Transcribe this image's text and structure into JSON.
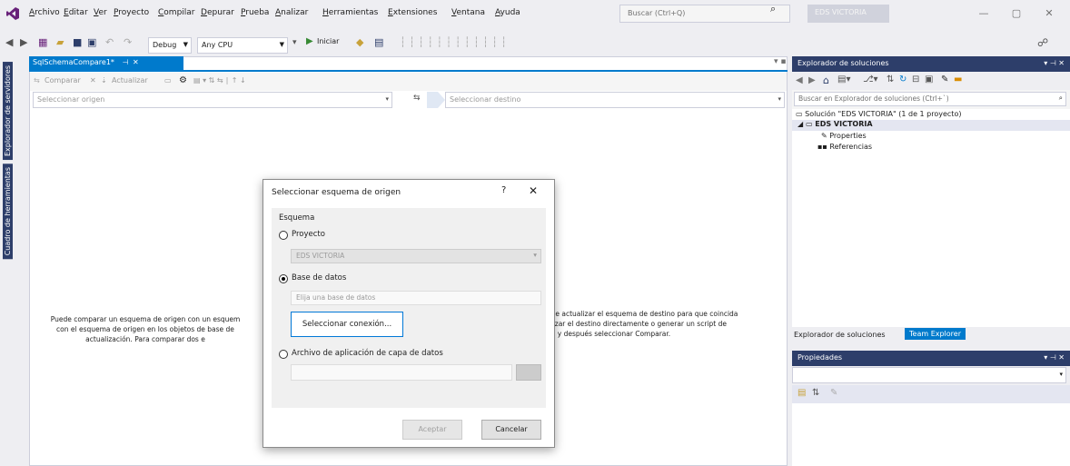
{
  "menu": [
    "Archivo",
    "Editar",
    "Ver",
    "Proyecto",
    "Compilar",
    "Depurar",
    "Prueba",
    "Analizar",
    "Herramientas",
    "Extensiones",
    "Ventana",
    "Ayuda"
  ],
  "search": {
    "placeholder": "Buscar (Ctrl+Q)"
  },
  "solution_badge": "EDS VICTORIA",
  "toolbar": {
    "config": "Debug",
    "platform": "Any CPU",
    "start": "Iniciar"
  },
  "left_rail": {
    "tab1": "Explorador de servidores",
    "tab2": "Cuadro de herramientas"
  },
  "document": {
    "tab_title": "SqlSchemaCompare1*",
    "toolbar_compare": "Comparar",
    "toolbar_update": "Actualizar",
    "source_placeholder": "Seleccionar origen",
    "target_placeholder": "Seleccionar destino",
    "desc_left": "Puede comparar un esquema de origen con un esquema de destino. Puede actualizar el esquema de destino para que coincida con el esquema de origen en los objetos de base de datos.",
    "desc_right": "ede actualizar el esquema de destino para que coincida alizar el destino directamente o generar un script de en y después seleccionar Comparar.",
    "desc_left_line1": "Puede comparar un esquema de origen con un esquem",
    "desc_left_line2": "con el esquema de origen en los objetos de base de",
    "desc_left_line3": "actualización. Para comparar dos e",
    "desc_right_line1": "ede actualizar el esquema de destino para que coincida",
    "desc_right_line2": "alizar el destino directamente o generar un script de",
    "desc_right_line3": "en y después seleccionar Comparar."
  },
  "dialog": {
    "title": "Seleccionar esquema de origen",
    "help": "?",
    "close": "✕",
    "section": "Esquema",
    "opt_project": "Proyecto",
    "project_value": "EDS VICTORIA",
    "opt_database": "Base de datos",
    "database_placeholder": "Elija una base de datos",
    "select_connection": "Seleccionar conexión...",
    "opt_dacpac": "Archivo de aplicación de capa de datos",
    "ok": "Aceptar",
    "cancel": "Cancelar",
    "selected_option": "database"
  },
  "solution_explorer": {
    "title": "Explorador de soluciones",
    "search_placeholder": "Buscar en Explorador de soluciones (Ctrl+`)",
    "solution_line": "Solución \"EDS VICTORIA\" (1 de 1 proyecto)",
    "project": "EDS VICTORIA",
    "properties": "Properties",
    "references": "Referencias",
    "tab_explorer": "Explorador de soluciones",
    "tab_team": "Team Explorer"
  },
  "properties_panel": {
    "title": "Propiedades"
  },
  "colors": {
    "accent": "#007acc",
    "panel_header": "#2d3e6a",
    "background": "#eeeef2"
  }
}
